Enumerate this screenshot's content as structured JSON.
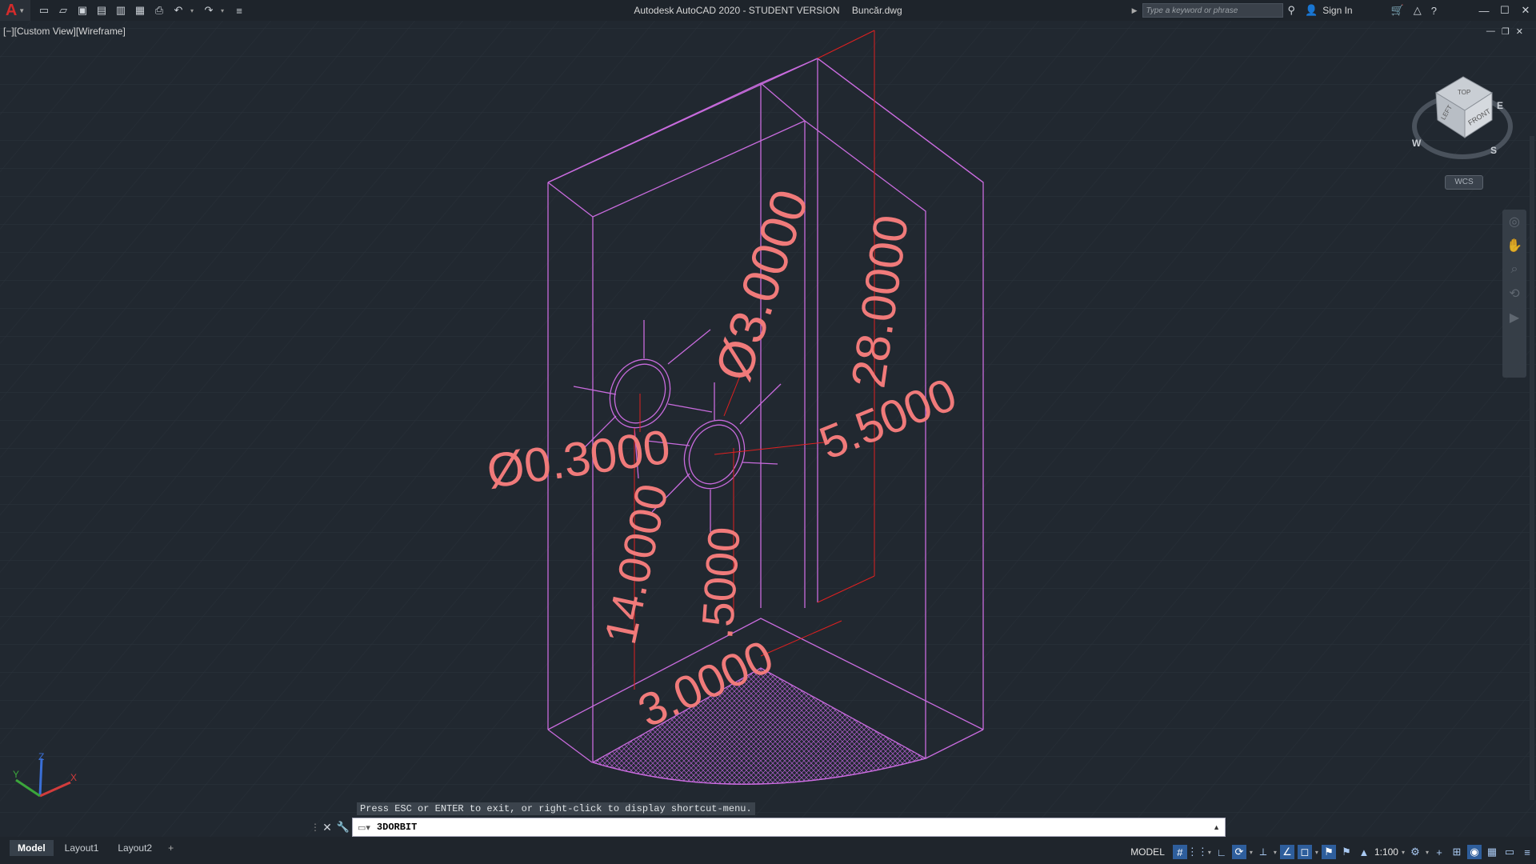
{
  "app": {
    "title": "Autodesk AutoCAD 2020 - STUDENT VERSION",
    "filename": "Buncăr.dwg"
  },
  "search": {
    "placeholder": "Type a keyword or phrase"
  },
  "account": {
    "signin_label": "Sign In"
  },
  "viewport": {
    "label": "[−][Custom View][Wireframe]"
  },
  "drawing": {
    "dimensions": [
      "Ø3.0000",
      "28.0000",
      "5.5000",
      "Ø0.3000",
      "14.0000",
      ".5000",
      "3.0000"
    ],
    "colors": {
      "geometry": "#c86bdd",
      "dimension_text": "#f07a7a",
      "dimension_lines": "#e02020",
      "background": "#212830"
    }
  },
  "viewcube": {
    "faces": {
      "top": "TOP",
      "left": "LEFT",
      "front": "FRONT"
    },
    "compass": {
      "w": "W",
      "s": "S",
      "e": "E"
    },
    "ucs_menu": "WCS"
  },
  "ucs_icon": {
    "x": "X",
    "y": "Y",
    "z": "Z"
  },
  "command": {
    "tooltip": "Press ESC or ENTER to exit, or right-click to display shortcut-menu.",
    "current": "3DORBIT"
  },
  "layout_tabs": [
    {
      "label": "Model",
      "active": true
    },
    {
      "label": "Layout1",
      "active": false
    },
    {
      "label": "Layout2",
      "active": false
    },
    {
      "label": "+",
      "active": false
    }
  ],
  "status": {
    "mode": "MODEL",
    "scale": "1:100"
  },
  "icons": [
    "application-menu-icon",
    "new-icon",
    "open-icon",
    "save-icon",
    "save-as-icon",
    "plot-icon",
    "undo-icon",
    "redo-icon",
    "search-icon",
    "signin-user-icon",
    "cart-icon",
    "help-icon",
    "minimize-icon",
    "maximize-icon",
    "close-icon",
    "grid-icon",
    "snap-icon",
    "ortho-icon",
    "polar-icon",
    "osnap-icon",
    "settings-icon",
    "customize-icon"
  ]
}
